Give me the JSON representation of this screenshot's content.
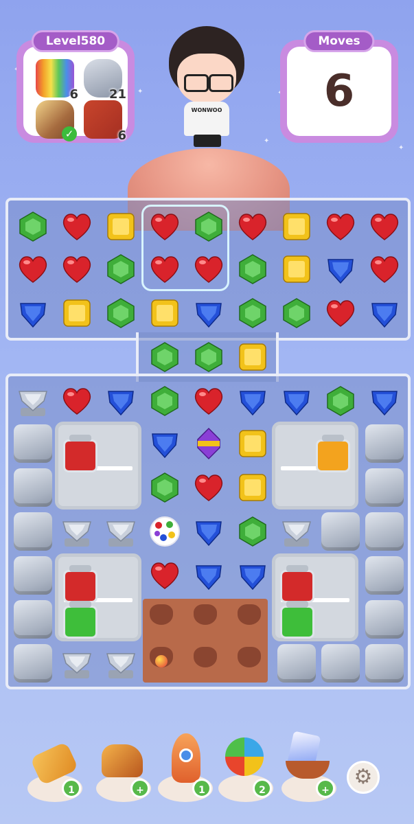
{
  "hud": {
    "level_label": "Level580",
    "moves_label": "Moves",
    "moves_value": "6",
    "goals": [
      {
        "name": "rainbow-jar",
        "count": "6"
      },
      {
        "name": "stone",
        "count": "21"
      },
      {
        "name": "paint-roller",
        "count": "",
        "completed": true
      },
      {
        "name": "gift-box",
        "count": "6"
      }
    ]
  },
  "avatar": {
    "shirt_text": "WONWOO"
  },
  "boosters": [
    {
      "name": "hammer",
      "count": "1"
    },
    {
      "name": "cannon",
      "count": "+"
    },
    {
      "name": "rocket",
      "count": "1"
    },
    {
      "name": "pinwheel",
      "count": "2"
    },
    {
      "name": "boat-card",
      "count": "+"
    }
  ],
  "colors": {
    "red": "#d9232b",
    "green": "#3fae3a",
    "yellow": "#f2c21a",
    "blue": "#2450d8",
    "accent": "#a45cc7"
  }
}
